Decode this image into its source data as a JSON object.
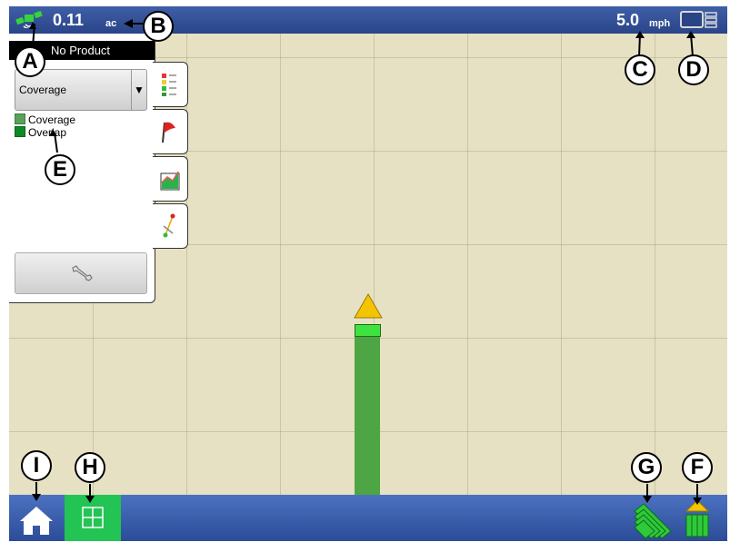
{
  "topbar": {
    "gps_icon": "gps-antenna-icon",
    "area_value": "0.11",
    "area_unit": "ac",
    "speed_value": "5.0",
    "speed_unit": "mph",
    "display_icon": "display-toggle-icon"
  },
  "panel": {
    "product": "No Product",
    "dropdown_value": "Coverage",
    "dropdown_arrow": "▼",
    "legend": [
      {
        "label": "Coverage",
        "color": "#5aa05a"
      },
      {
        "label": "Overlap",
        "color": "#0b8a26"
      }
    ],
    "settings_icon": "wrench-icon",
    "tabs": [
      "legend-tab",
      "flag-tab",
      "summary-tab",
      "guidance-tab"
    ]
  },
  "map": {
    "vehicle_color": "#f5c400",
    "implement_color": "#3fe33f",
    "coverage_color": "#4ea544",
    "background_color": "#e7e1c4"
  },
  "bottombar": {
    "home_icon": "home-icon",
    "map_icon": "map-view-icon",
    "passes_icon": "guidance-passes-icon",
    "implement_icon": "implement-icon"
  },
  "callouts": {
    "a": "A",
    "b": "B",
    "c": "C",
    "d": "D",
    "e": "E",
    "f": "F",
    "g": "G",
    "h": "H",
    "i": "I"
  }
}
